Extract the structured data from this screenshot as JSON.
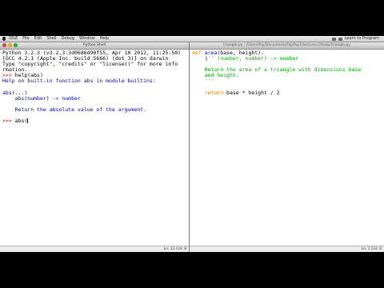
{
  "menubar": {
    "items": [
      "IDLE",
      "File",
      "Edit",
      "Shell",
      "Debug",
      "Window",
      "Help"
    ],
    "right_text": "Learn to Program"
  },
  "shell": {
    "window_title": "Python Shell",
    "lines": [
      "Python 3.2.3 (v3.2.3:3d0686d90f55, Apr 10 2012, 11:25:50)",
      "[GCC 4.2.1 (Apple Inc. build 5666) (dot 3)] on darwin",
      "Type \"copyright\", \"credits\" or \"license()\" for more info",
      "rmation."
    ],
    "cmd1_prompt": ">>> ",
    "cmd1": "help(abs)",
    "help_header": "Help on built-in function abs in module builtins:",
    "help_sig": "abs(...)",
    "help_sig2": "    abs(number) -> number",
    "help_desc": "    Return the absolute value of the argument.",
    "cmd2_prompt": ">>> ",
    "cmd2": "abs(",
    "status": "Ln: 12 Col: 8"
  },
  "editor": {
    "window_title": "triangle.py - /Users/fsp/Documents/fsp/fsp1/lectures/3/help/triangle.py",
    "def_kw": "def ",
    "func_name": "area",
    "params": "(base, height):",
    "doc_line1": "    ''' (number, number) -> number",
    "doc_line2": "    Return the area of a triangle with dimensions base",
    "doc_line3": "    and height.",
    "doc_line4": "    '''",
    "return_kw": "    return ",
    "return_expr": "base * height / 2",
    "status": "Ln: 1 Col: 0"
  }
}
